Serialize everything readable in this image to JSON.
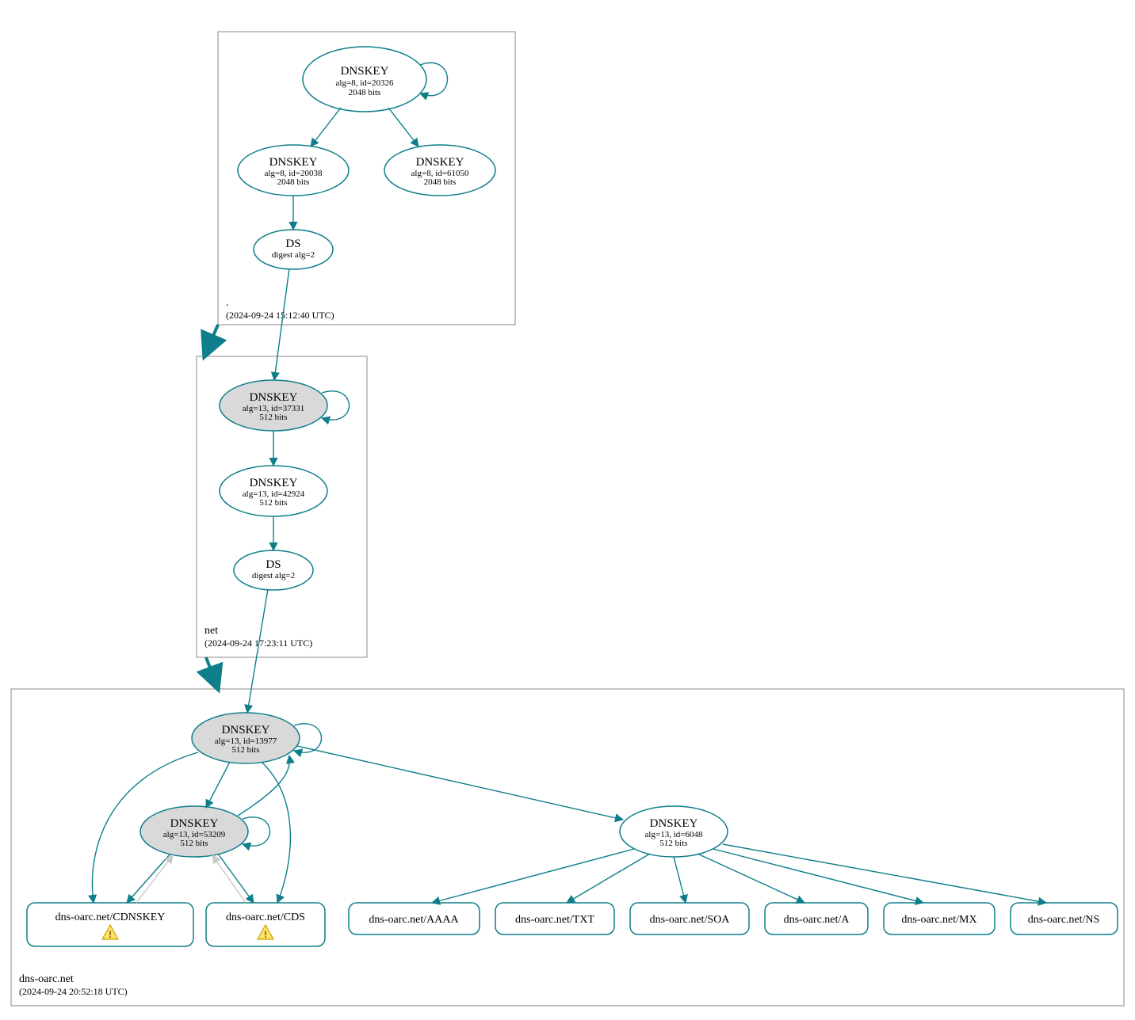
{
  "colors": {
    "accent": "#0d7e8a",
    "ksk_fill": "#d9d9d9"
  },
  "zones": {
    "root": {
      "name": ".",
      "timestamp": "(2024-09-24 15:12:40 UTC)"
    },
    "net": {
      "name": "net",
      "timestamp": "(2024-09-24 17:23:11 UTC)"
    },
    "leaf": {
      "name": "dns-oarc.net",
      "timestamp": "(2024-09-24 20:52:18 UTC)"
    }
  },
  "nodes": {
    "root_ksk": {
      "title": "DNSKEY",
      "sub1": "alg=8, id=20326",
      "sub2": "2048 bits"
    },
    "root_zsk1": {
      "title": "DNSKEY",
      "sub1": "alg=8, id=20038",
      "sub2": "2048 bits"
    },
    "root_zsk2": {
      "title": "DNSKEY",
      "sub1": "alg=8, id=61050",
      "sub2": "2048 bits"
    },
    "root_ds": {
      "title": "DS",
      "sub1": "digest alg=2"
    },
    "net_ksk": {
      "title": "DNSKEY",
      "sub1": "alg=13, id=37331",
      "sub2": "512 bits"
    },
    "net_zsk": {
      "title": "DNSKEY",
      "sub1": "alg=13, id=42924",
      "sub2": "512 bits"
    },
    "net_ds": {
      "title": "DS",
      "sub1": "digest alg=2"
    },
    "leaf_ksk": {
      "title": "DNSKEY",
      "sub1": "alg=13, id=13977",
      "sub2": "512 bits"
    },
    "leaf_zsk1": {
      "title": "DNSKEY",
      "sub1": "alg=13, id=53209",
      "sub2": "512 bits"
    },
    "leaf_zsk2": {
      "title": "DNSKEY",
      "sub1": "alg=13, id=6048",
      "sub2": "512 bits"
    }
  },
  "rrsets": {
    "cdnskey": "dns-oarc.net/CDNSKEY",
    "cds": "dns-oarc.net/CDS",
    "aaaa": "dns-oarc.net/AAAA",
    "txt": "dns-oarc.net/TXT",
    "soa": "dns-oarc.net/SOA",
    "a": "dns-oarc.net/A",
    "mx": "dns-oarc.net/MX",
    "ns": "dns-oarc.net/NS"
  },
  "icons": {
    "warning": "warning-icon"
  }
}
